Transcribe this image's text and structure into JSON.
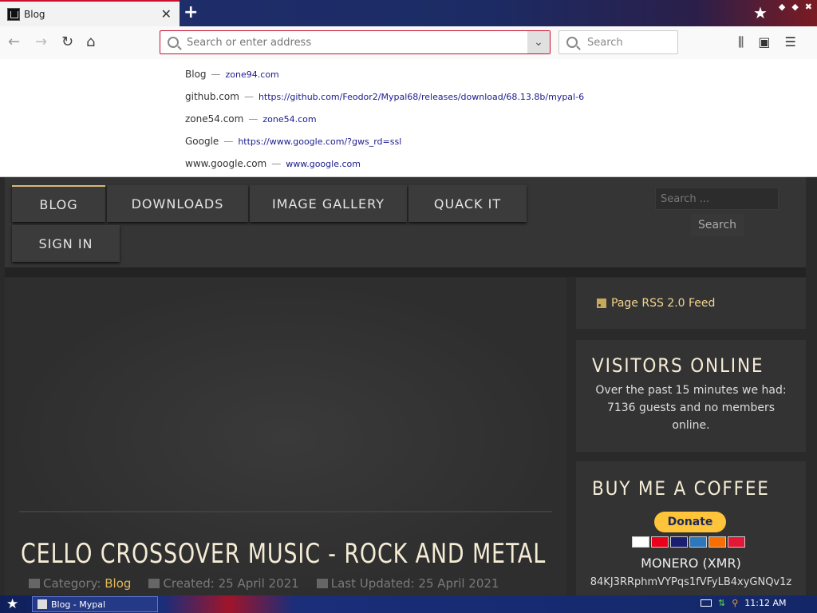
{
  "browser": {
    "tab_title": "Blog",
    "url_placeholder": "Search or enter address",
    "search_placeholder": "Search"
  },
  "suggestions": [
    {
      "title": "Blog",
      "url": "zone94.com"
    },
    {
      "title": "github.com",
      "url": "https://github.com/Feodor2/Mypal68/releases/download/68.13.8b/mypal-6"
    },
    {
      "title": "zone54.com",
      "url": "zone54.com"
    },
    {
      "title": "Google",
      "url": "https://www.google.com/?gws_rd=ssl"
    },
    {
      "title": "www.google.com",
      "url": "www.google.com"
    }
  ],
  "site": {
    "menu": [
      "BLOG",
      "DOWNLOADS",
      "IMAGE GALLERY",
      "QUACK IT",
      "SIGN IN"
    ],
    "search_placeholder": "Search ...",
    "search_button": "Search",
    "article": {
      "title": "CELLO CROSSOVER MUSIC - ROCK AND METAL",
      "category_label": "Category:",
      "category": "Blog",
      "created": "Created: 25 April 2021",
      "updated": "Last Updated: 25 April 2021"
    },
    "rss": "Page RSS 2.0 Feed",
    "visitors": {
      "title": "VISITORS ONLINE",
      "text": "Over the past 15 minutes we had: 7136 guests and no members online."
    },
    "coffee": {
      "title": "BUY ME A COFFEE",
      "donate": "Donate",
      "monero": "MONERO (XMR)",
      "address": "84KJ3RRphmVYPqs1fVFyLB4xyGNQv1z"
    }
  },
  "taskbar": {
    "item": "Blog - Mypal",
    "time": "11:12 AM"
  },
  "colors": {
    "accent_red": "#c8102e",
    "gold": "#e0b85a"
  }
}
